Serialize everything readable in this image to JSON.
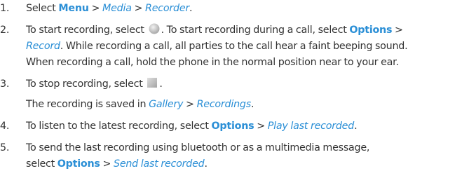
{
  "steps": [
    {
      "number": "1.",
      "text_1": "Select ",
      "menu": "Menu",
      "sep_1": " > ",
      "path_1": "Media",
      "sep_2": " > ",
      "path_2": "Recorder",
      "end": "."
    },
    {
      "number": "2.",
      "line1_before_icon": "To start recording, select ",
      "line1_after_icon": ". To start recording during a call, select ",
      "options": "Options",
      "sep": " >",
      "record": "Record",
      "line2_rest": ". While recording a call, all parties to the call hear a faint beeping sound.",
      "line3": "When recording a call, hold the phone in the normal position near to your ear.",
      "icon": "record-icon"
    },
    {
      "number": "3.",
      "text_before_icon": "To stop recording, select ",
      "text_after_icon": ".",
      "icon": "stop-icon",
      "sub_text_1": "The recording is saved in ",
      "gallery": "Gallery",
      "sep": " > ",
      "recordings": "Recordings",
      "sub_end": "."
    },
    {
      "number": "4.",
      "text_1": "To listen to the latest recording, select ",
      "options": "Options",
      "sep": " > ",
      "play": "Play last recorded",
      "end": "."
    },
    {
      "number": "5.",
      "line1": "To send the last recording using bluetooth or as a multimedia message,",
      "line2_start": "select ",
      "options": "Options",
      "sep": " > ",
      "send": "Send last recorded",
      "end": "."
    }
  ],
  "colors": {
    "link": "#2b8fd6",
    "text": "#333333",
    "icon_gray": "#c0c0c0"
  }
}
